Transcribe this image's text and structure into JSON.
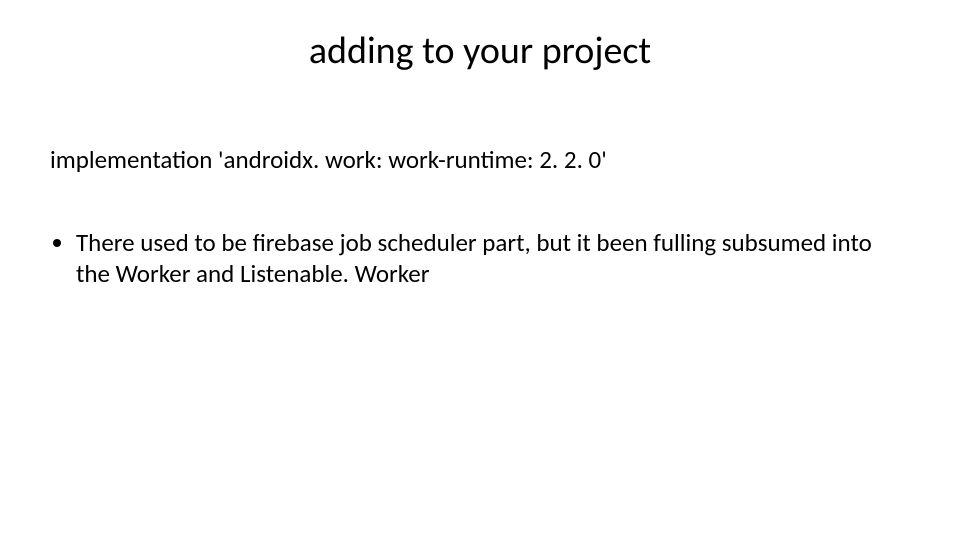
{
  "title": "adding to your project",
  "line1": "implementation 'androidx. work: work-runtime: 2. 2. 0'",
  "bullet1": "There used to be firebase job scheduler part, but it been fulling subsumed into the Worker and Listenable. Worker"
}
